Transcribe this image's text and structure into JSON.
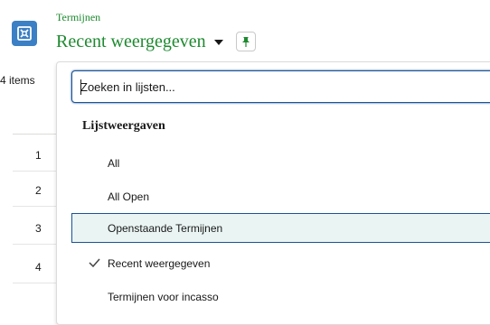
{
  "header": {
    "object_label": "Termijnen",
    "title": "Recent weergegeven",
    "object_icon": "contract-icon",
    "pin_icon": "pin-icon"
  },
  "list": {
    "items_count": "4 items",
    "rows": [
      "1",
      "2",
      "3",
      "4"
    ]
  },
  "dropdown": {
    "search_placeholder": "Zoeken in lijsten...",
    "section_title": "Lijstweergaven",
    "options": [
      {
        "label": "All"
      },
      {
        "label": "All Open"
      },
      {
        "label": "Openstaande Termijnen",
        "focused": true
      },
      {
        "label": "Recent weergegeven",
        "checked": true
      },
      {
        "label": "Termijnen voor incasso"
      }
    ]
  },
  "colors": {
    "brand_green": "#1d8a2f",
    "icon_blue": "#3b7fc4",
    "focus_blue": "#1b5297",
    "focus_bg": "#eaf5f3"
  }
}
